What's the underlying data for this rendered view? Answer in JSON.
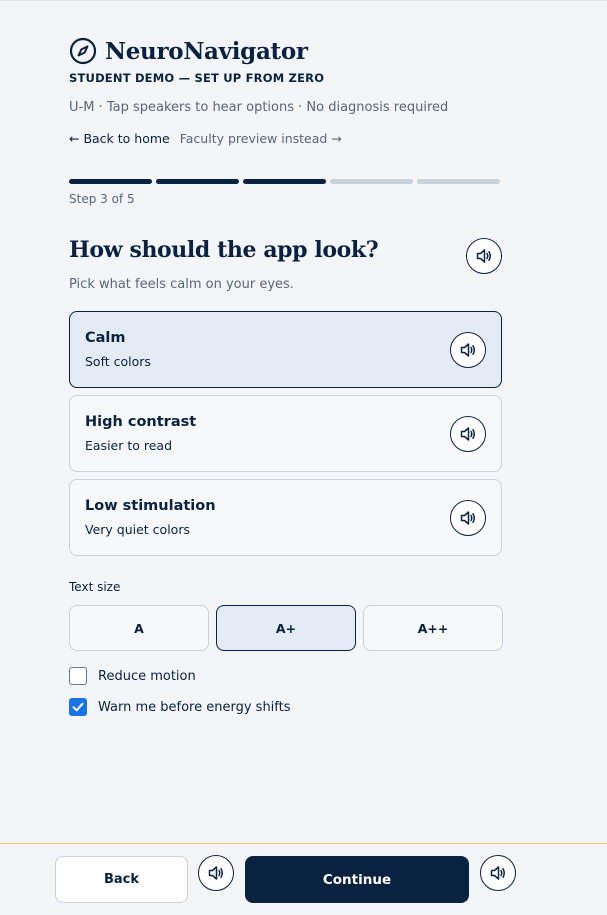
{
  "app": {
    "brand_name": "NeuroNavigator",
    "subtitle": "STUDENT DEMO — SET UP FROM ZERO",
    "meta": "U-M · Tap speakers to hear options · No diagnosis required",
    "back_home": "← Back to home",
    "faculty_preview": "Faculty preview instead →"
  },
  "progress": {
    "current_step": 3,
    "total_steps": 5,
    "label": "Step 3 of 5"
  },
  "question": {
    "title": "How should the app look?",
    "lead": "Pick what feels calm on your eyes."
  },
  "options": [
    {
      "title": "Calm",
      "desc": "Soft colors",
      "selected": true
    },
    {
      "title": "High contrast",
      "desc": "Easier to read",
      "selected": false
    },
    {
      "title": "Low stimulation",
      "desc": "Very quiet colors",
      "selected": false
    }
  ],
  "text_size": {
    "label": "Text size",
    "options": [
      "A",
      "A+",
      "A++"
    ],
    "selected": "A+"
  },
  "checkboxes": [
    {
      "label": "Reduce motion",
      "checked": false
    },
    {
      "label": "Warn me before energy shifts",
      "checked": true
    }
  ],
  "footer": {
    "back_label": "Back",
    "continue_label": "Continue"
  },
  "colors": {
    "navy": "#0a2240",
    "selected_bg": "#e3ebf4",
    "checkbox_blue": "#1a73e8",
    "footer_border": "#e2c878"
  },
  "icons": {
    "logo": "compass-icon",
    "speaker": "speaker-icon",
    "check": "checkmark-icon"
  }
}
